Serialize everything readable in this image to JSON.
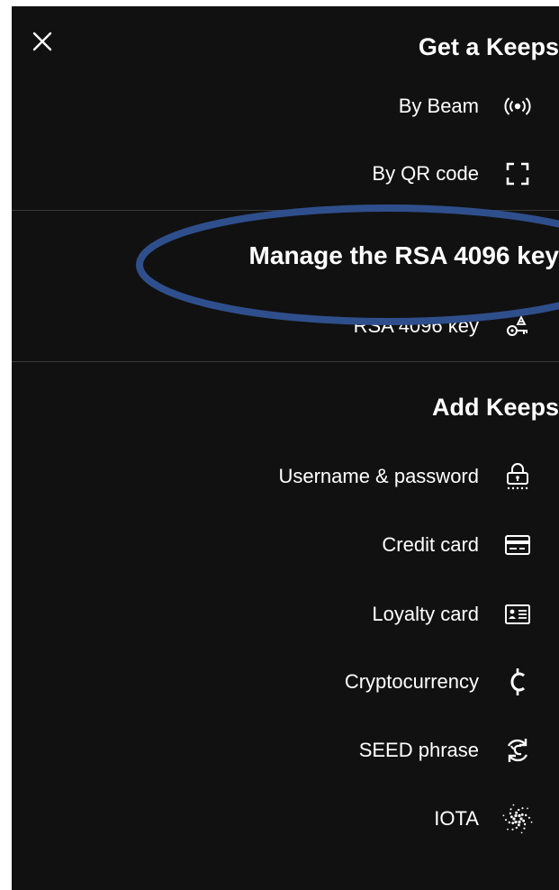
{
  "get_keeps": {
    "title": "Get a Keeps",
    "items": [
      {
        "label": "By Beam",
        "icon": "beam-icon"
      },
      {
        "label": "By QR code",
        "icon": "qr-scan-icon"
      }
    ]
  },
  "rsa": {
    "title": "Manage the RSA 4096 key",
    "items": [
      {
        "label": "RSA 4096 key",
        "icon": "key-icon"
      }
    ]
  },
  "add_keeps": {
    "title": "Add Keeps",
    "items": [
      {
        "label": "Username & password",
        "icon": "lock-icon"
      },
      {
        "label": "Credit card",
        "icon": "credit-card-icon"
      },
      {
        "label": "Loyalty card",
        "icon": "id-card-icon"
      },
      {
        "label": "Cryptocurrency",
        "icon": "cent-icon"
      },
      {
        "label": "SEED phrase",
        "icon": "seed-refresh-icon"
      },
      {
        "label": "IOTA",
        "icon": "iota-icon"
      }
    ]
  },
  "colors": {
    "background": "#111111",
    "text": "#ffffff",
    "highlight_ring": "#2f4f8c",
    "divider": "#3a3a3a"
  }
}
